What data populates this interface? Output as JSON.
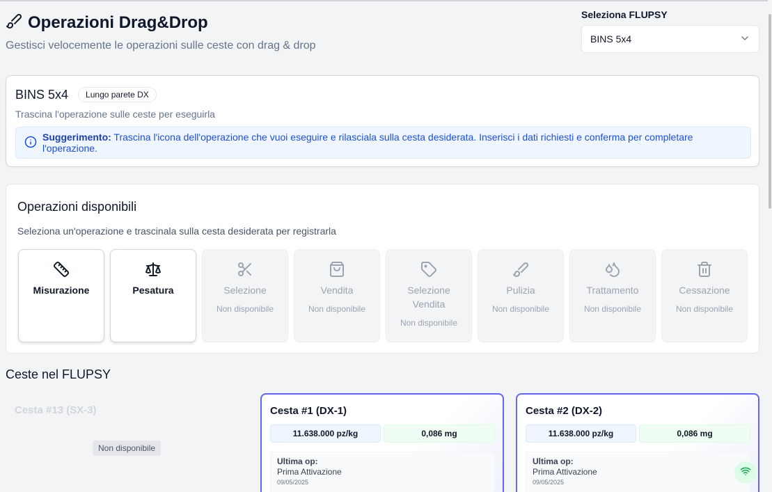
{
  "header": {
    "title": "Operazioni Drag&Drop",
    "subtitle": "Gestisci velocemente le operazioni sulle ceste con drag & drop",
    "icon": "brush-icon"
  },
  "flupsy_select": {
    "label": "Seleziona FLUPSY",
    "value": "BINS 5x4"
  },
  "flupsy_info": {
    "name": "BINS 5x4",
    "badge": "Lungo parete DX",
    "description": "Trascina l'operazione sulle ceste per eseguirla",
    "tip_label": "Suggerimento:",
    "tip_text": "Trascina l'icona dell'operazione che vuoi eseguire e rilasciala sulla cesta desiderata. Inserisci i dati richiesti e conferma per completare l'operazione."
  },
  "operations": {
    "title": "Operazioni disponibili",
    "description": "Seleziona un'operazione e trascinala sulla cesta desiderata per registrarla",
    "unavailable_label": "Non disponibile",
    "items": [
      {
        "label": "Misurazione",
        "icon": "ruler-icon",
        "enabled": true
      },
      {
        "label": "Pesatura",
        "icon": "scale-icon",
        "enabled": true
      },
      {
        "label": "Selezione",
        "icon": "scissors-icon",
        "enabled": false
      },
      {
        "label": "Vendita",
        "icon": "shopping-bag-icon",
        "enabled": false
      },
      {
        "label": "Selezione Vendita",
        "icon": "tag-icon",
        "enabled": false
      },
      {
        "label": "Pulizia",
        "icon": "brush-icon",
        "enabled": false
      },
      {
        "label": "Trattamento",
        "icon": "droplets-icon",
        "enabled": false
      },
      {
        "label": "Cessazione",
        "icon": "trash-icon",
        "enabled": false
      }
    ]
  },
  "baskets": {
    "title": "Ceste nel FLUPSY",
    "items": [
      {
        "name": "Cesta #13 (SX-3)",
        "status": "Non disponibile"
      },
      {
        "name": "Cesta #1 (DX-1)",
        "density": "11.638.000 pz/kg",
        "weight": "0,086 mg",
        "last_op_label": "Ultima op:",
        "last_op": "Prima Attivazione",
        "date": "09/05/2025"
      },
      {
        "name": "Cesta #2 (DX-2)",
        "density": "11.638.000 pz/kg",
        "weight": "0,086 mg",
        "last_op_label": "Ultima op:",
        "last_op": "Prima Attivazione",
        "date": "09/05/2025"
      }
    ]
  },
  "colors": {
    "accent": "#6366f1",
    "tip_text": "#1d4ed8",
    "connected": "#16a34a"
  }
}
